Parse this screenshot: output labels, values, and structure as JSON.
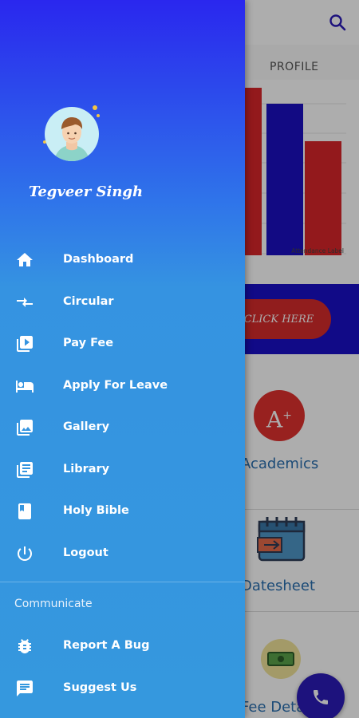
{
  "app": {
    "tab_profile": "PROFILE",
    "chart_axis_label": "Attendance Label",
    "banner_button": "CLICK HERE",
    "cards": [
      {
        "label": "Academics"
      },
      {
        "label": "Datesheet"
      },
      {
        "label": "Fee Deta"
      }
    ]
  },
  "drawer": {
    "user_name": "Tegveer Singh",
    "menu": [
      {
        "label": "Dashboard",
        "icon": "home-icon"
      },
      {
        "label": "Circular",
        "icon": "swap-arrows-icon"
      },
      {
        "label": "Pay Fee",
        "icon": "video-library-icon"
      },
      {
        "label": "Apply For Leave",
        "icon": "hotel-bed-icon"
      },
      {
        "label": "Gallery",
        "icon": "photo-library-icon"
      },
      {
        "label": "Library",
        "icon": "library-books-icon"
      },
      {
        "label": "Holy Bible",
        "icon": "book-icon"
      },
      {
        "label": "Logout",
        "icon": "power-icon"
      }
    ],
    "section_header": "Communicate",
    "menu2": [
      {
        "label": "Report A Bug",
        "icon": "bug-icon"
      },
      {
        "label": "Suggest Us",
        "icon": "feedback-icon"
      }
    ]
  },
  "colors": {
    "drawer_top": "#2a27ee",
    "drawer_bottom": "#3598de",
    "banner": "#1a10c8",
    "accent_red": "#d62b2b",
    "fab": "#2b1bb8"
  }
}
